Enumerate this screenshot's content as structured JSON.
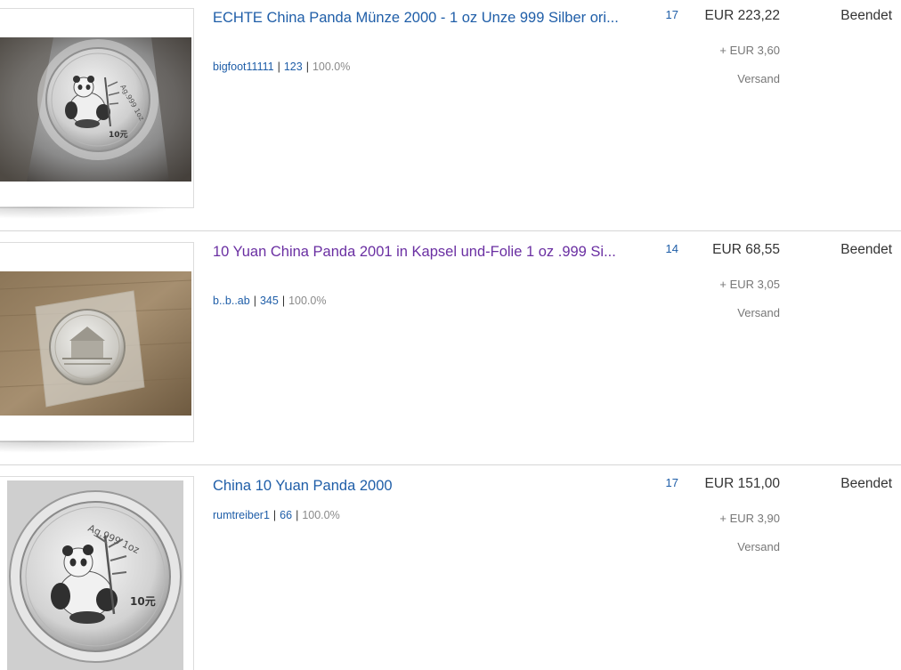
{
  "listings": [
    {
      "title": "ECHTE China Panda Münze 2000 - 1 oz Unze 999 Silber ori...",
      "seller_name": "bigfoot11111",
      "feedback_count": "123",
      "feedback_percent": "100.0%",
      "bids": "17",
      "price": "EUR 223,22",
      "shipping_cost": "+ EUR 3,60",
      "shipping_label": "Versand",
      "status": "Beendet",
      "coin_text": "Ag.999 1oz",
      "coin_value": "10元"
    },
    {
      "title": "10 Yuan China Panda 2001 in Kapsel und-Folie 1 oz .999 Si...",
      "seller_name": "b..b..ab",
      "feedback_count": "345",
      "feedback_percent": "100.0%",
      "bids": "14",
      "price": "EUR 68,55",
      "shipping_cost": "+ EUR 3,05",
      "shipping_label": "Versand",
      "status": "Beendet"
    },
    {
      "title": "China 10 Yuan Panda 2000",
      "seller_name": "rumtreiber1",
      "feedback_count": "66",
      "feedback_percent": "100.0%",
      "bids": "17",
      "price": "EUR 151,00",
      "shipping_cost": "+ EUR 3,90",
      "shipping_label": "Versand",
      "status": "Beendet",
      "coin_text": "Ag.999 1oz",
      "coin_value": "10元"
    }
  ]
}
